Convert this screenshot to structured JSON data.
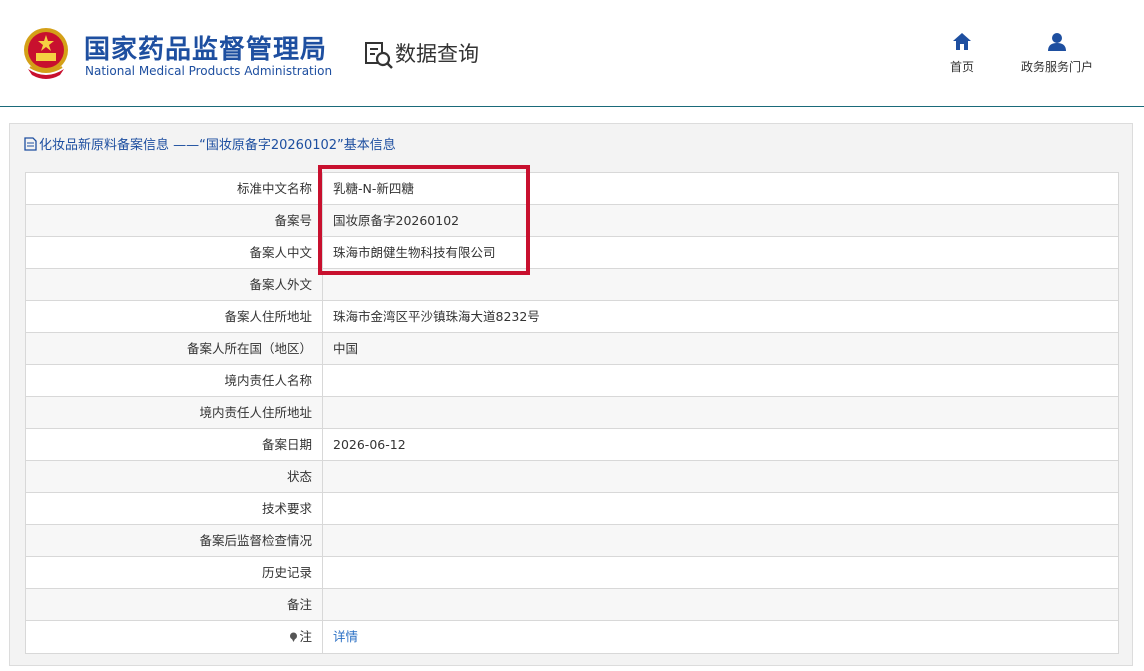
{
  "header": {
    "org_cn": "国家药品监督管理局",
    "org_en": "National Medical Products Administration",
    "section": "数据查询",
    "nav": [
      {
        "label": "首页",
        "icon": "home-icon"
      },
      {
        "label": "政务服务门户",
        "icon": "user-icon"
      }
    ]
  },
  "panel": {
    "title": "化妆品新原料备案信息 ——“国妆原备字20260102”基本信息"
  },
  "rows": [
    {
      "label": "标准中文名称",
      "value": "乳糖-N-新四糖"
    },
    {
      "label": "备案号",
      "value": "国妆原备字20260102"
    },
    {
      "label": "备案人中文",
      "value": "珠海市朗健生物科技有限公司"
    },
    {
      "label": "备案人外文",
      "value": ""
    },
    {
      "label": "备案人住所地址",
      "value": "珠海市金湾区平沙镇珠海大道8232号"
    },
    {
      "label": "备案人所在国（地区）",
      "value": "中国"
    },
    {
      "label": "境内责任人名称",
      "value": ""
    },
    {
      "label": "境内责任人住所地址",
      "value": ""
    },
    {
      "label": "备案日期",
      "value": "2026-06-12"
    },
    {
      "label": "状态",
      "value": ""
    },
    {
      "label": "技术要求",
      "value": ""
    },
    {
      "label": "备案后监督检查情况",
      "value": ""
    },
    {
      "label": "历史记录",
      "value": ""
    },
    {
      "label": "备注",
      "value": ""
    },
    {
      "label": "注",
      "value": "详情"
    }
  ],
  "colors": {
    "brand": "#1e4fa0",
    "highlight": "#c8102e",
    "link": "#2a6fc4"
  }
}
